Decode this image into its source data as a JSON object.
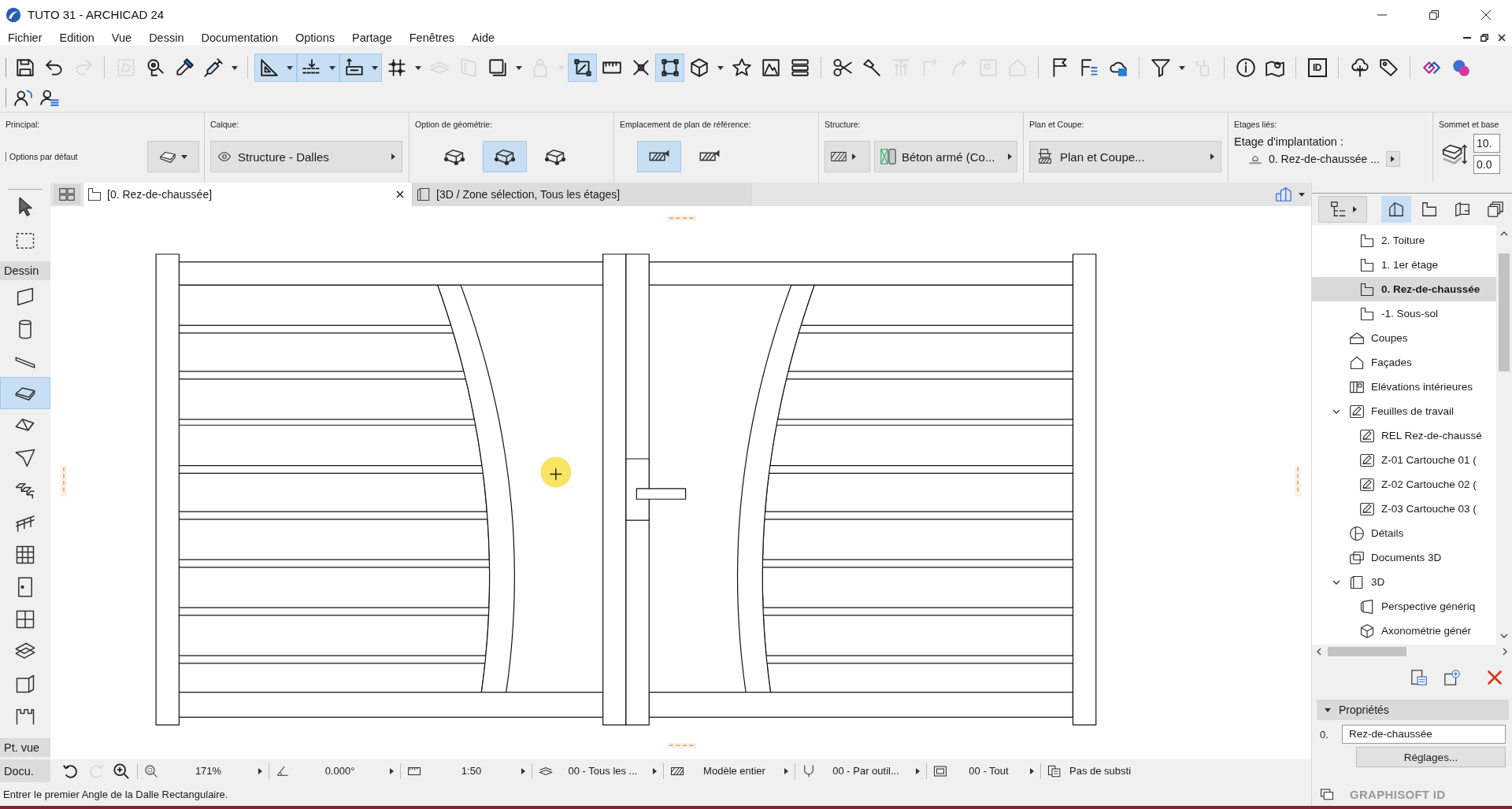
{
  "window": {
    "title": "TUTO 31 - ARCHICAD 24"
  },
  "menu": [
    "Fichier",
    "Edition",
    "Vue",
    "Dessin",
    "Documentation",
    "Options",
    "Partage",
    "Fenêtres",
    "Aide"
  ],
  "toolbars": [
    [
      [
        {
          "on": false,
          "disabled": false
        },
        {
          "on": false,
          "disabled": false
        },
        {
          "on": false,
          "disabled": true
        }
      ],
      [
        {
          "on": false,
          "disabled": true
        },
        {
          "on": false,
          "disabled": false
        },
        {
          "on": false,
          "disabled": false
        },
        {
          "on": false,
          "disabled": false,
          "dropdown": true
        }
      ],
      [
        {
          "on": true,
          "disabled": false,
          "dropdown": true
        },
        {
          "on": true,
          "disabled": false,
          "dropdown": true
        },
        {
          "on": true,
          "disabled": false,
          "dropdown": true
        },
        {
          "on": false,
          "disabled": false,
          "dropdown": true
        },
        {
          "on": false,
          "disabled": true
        },
        {
          "on": false,
          "disabled": true
        },
        {
          "on": false,
          "disabled": false,
          "dropdown": true
        },
        {
          "on": false,
          "disabled": true,
          "dropdown": true
        },
        {
          "on": true,
          "disabled": false
        },
        {
          "on": false,
          "disabled": false
        },
        {
          "on": false,
          "disabled": false
        },
        {
          "on": true,
          "disabled": false
        },
        {
          "on": false,
          "disabled": false,
          "dropdown": true
        },
        {
          "on": false,
          "disabled": false
        },
        {
          "on": false,
          "disabled": false
        },
        {
          "on": false,
          "disabled": false
        }
      ],
      [
        {
          "on": false,
          "disabled": false
        },
        {
          "on": false,
          "disabled": false
        },
        {
          "on": false,
          "disabled": true
        },
        {
          "on": false,
          "disabled": true
        },
        {
          "on": false,
          "disabled": true
        },
        {
          "on": false,
          "disabled": true
        },
        {
          "on": false,
          "disabled": true
        }
      ],
      [
        {
          "on": false,
          "disabled": false
        },
        {
          "on": false,
          "disabled": false
        },
        {
          "on": false,
          "disabled": false
        }
      ],
      [
        {
          "on": false,
          "disabled": false,
          "dropdown": true
        },
        {
          "on": false,
          "disabled": true
        }
      ],
      [
        {
          "on": false,
          "disabled": false
        },
        {
          "on": false,
          "disabled": false
        }
      ],
      [
        {
          "on": false,
          "disabled": false,
          "label": "ID"
        }
      ],
      [
        {
          "on": false,
          "disabled": false
        },
        {
          "on": false,
          "disabled": false
        }
      ],
      [
        {
          "on": false,
          "disabled": false
        },
        {
          "on": false,
          "disabled": false
        }
      ]
    ],
    [
      [
        {
          "on": false,
          "disabled": false
        },
        {
          "on": false,
          "disabled": false
        }
      ]
    ]
  ],
  "info_box": {
    "principal": {
      "label": "Principal:",
      "preset": "Options par défaut"
    },
    "layer": {
      "label": "Calque:",
      "value": "Structure - Dalles"
    },
    "geometry": {
      "label": "Option de géométrie:",
      "options": [
        {
          "selected": false
        },
        {
          "selected": true
        },
        {
          "selected": false
        }
      ]
    },
    "reference_plane": {
      "label": "Emplacement de plan de référence:",
      "options": [
        {
          "selected": true
        },
        {
          "selected": false
        }
      ]
    },
    "structure": {
      "label": "Structure:",
      "value": "Béton armé (Co..."
    },
    "plan_section": {
      "label": "Plan et Coupe:",
      "value": "Plan et Coupe..."
    },
    "linked_stories": {
      "label": "Etages liés:",
      "caption": "Etage d'implantation :",
      "value": "0. Rez-de-chaussée ..."
    },
    "top_bottom": {
      "label": "Sommet et base",
      "values": [
        "10.",
        "0.0"
      ]
    }
  },
  "tabs": [
    {
      "label": "[0. Rez-de-chaussée]",
      "kind": "plan",
      "selected": true
    },
    {
      "label": "[3D / Zone sélection, Tous les étages]",
      "kind": "model",
      "selected": false
    }
  ],
  "toolbox": {
    "tools": [
      {
        "kind": "arrow",
        "selected": false
      },
      {
        "kind": "marquee",
        "selected": false
      }
    ],
    "groups": [
      {
        "title": "Dessin",
        "tools": [
          {
            "kind": "wall",
            "selected": false
          },
          {
            "kind": "column",
            "selected": false
          },
          {
            "kind": "beam",
            "selected": false
          },
          {
            "kind": "slab",
            "selected": true
          },
          {
            "kind": "roof",
            "selected": false
          },
          {
            "kind": "shell",
            "selected": false
          },
          {
            "kind": "stair",
            "selected": false
          },
          {
            "kind": "railing",
            "selected": false
          },
          {
            "kind": "curtainwall",
            "selected": false
          },
          {
            "kind": "door",
            "selected": false
          },
          {
            "kind": "window",
            "selected": false
          },
          {
            "kind": "skylight",
            "selected": false
          },
          {
            "kind": "cornerwindow",
            "selected": false
          },
          {
            "kind": "wallend",
            "selected": false
          }
        ]
      },
      {
        "title": "Pt. vue"
      },
      {
        "title": "Docu."
      }
    ]
  },
  "navigator": {
    "view_tabs": [
      {
        "selected": true
      },
      {
        "selected": false
      },
      {
        "selected": false
      },
      {
        "selected": false
      }
    ],
    "tree": [
      {
        "children": [
          {
            "label": "2. Toiture",
            "kind": "storey",
            "selected": false
          },
          {
            "label": "1. 1er étage",
            "kind": "storey",
            "selected": false
          },
          {
            "label": "0. Rez-de-chaussée",
            "kind": "storey",
            "selected": true
          },
          {
            "label": "-1. Sous-sol",
            "kind": "storey",
            "selected": false
          }
        ]
      },
      {
        "label": "Coupes",
        "kind": "section",
        "selected": false
      },
      {
        "label": "Façades",
        "kind": "elevation",
        "selected": false
      },
      {
        "label": "Elévations intérieures",
        "kind": "interior",
        "selected": false
      },
      {
        "label": "Feuilles de travail",
        "kind": "worksheet",
        "selected": false,
        "expanded": true,
        "children": [
          {
            "label": "REL Rez-de-chaussé",
            "kind": "worksheet",
            "selected": false
          },
          {
            "label": "Z-01 Cartouche 01 (",
            "kind": "worksheet",
            "selected": false
          },
          {
            "label": "Z-02 Cartouche 02 (",
            "kind": "worksheet",
            "selected": false
          },
          {
            "label": "Z-03 Cartouche 03 (",
            "kind": "worksheet",
            "selected": false
          }
        ]
      },
      {
        "label": "Détails",
        "kind": "detail",
        "selected": false
      },
      {
        "label": "Documents 3D",
        "kind": "document3d",
        "selected": false
      },
      {
        "label": "3D",
        "kind": "model3d",
        "selected": false,
        "expanded": true,
        "children": [
          {
            "label": "Perspective génériq",
            "kind": "perspective",
            "selected": false
          },
          {
            "label": "Axonométrie génér",
            "kind": "axonometry",
            "selected": false
          }
        ]
      }
    ],
    "properties": {
      "title": "Propriétés",
      "expanded": true,
      "id_label": "0.",
      "name": "Rez-de-chaussée",
      "settings_button": "Réglages..."
    },
    "footer": "GRAPHISOFT ID"
  },
  "status_bar": {
    "zoom_buttons": [
      {
        "disabled": false
      },
      {
        "disabled": true
      },
      {
        "disabled": false
      }
    ],
    "controls": [
      {
        "kind": "zoom",
        "value": "171%"
      },
      {
        "kind": "angle",
        "value": "0.000°"
      },
      {
        "kind": "scale",
        "value": "1:50"
      },
      {
        "kind": "layers",
        "value": "00 - Tous les ..."
      },
      {
        "kind": "model",
        "value": "Modèle entier"
      },
      {
        "kind": "pen",
        "value": "00 - Par outil..."
      },
      {
        "kind": "graphic",
        "value": "00 - Tout"
      },
      {
        "kind": "override",
        "value": "Pas de substi"
      }
    ],
    "message": "Entrer le premier Angle de la Dalle Rectangulaire."
  }
}
